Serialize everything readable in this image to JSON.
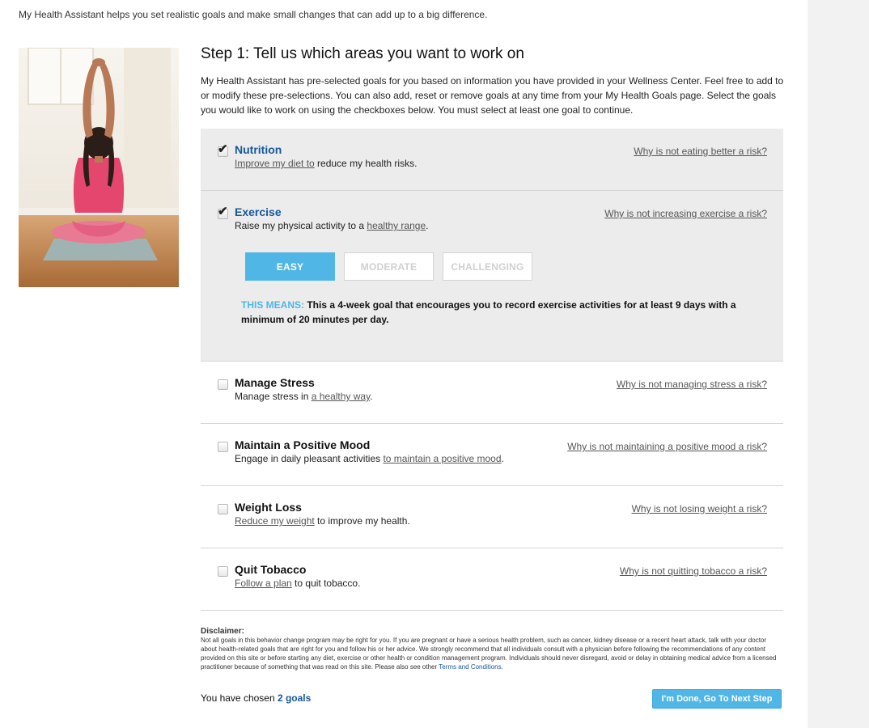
{
  "intro": "My Health Assistant helps you set realistic goals and make small changes that can add up to a big difference.",
  "step": {
    "title": "Step 1: Tell us which areas you want to work on",
    "description": "My Health Assistant has pre-selected goals for you based on information you have provided in your Wellness Center. Feel free to add to or modify these pre-selections. You can also add, reset or remove goals at any time from your My Health Goals page. Select the goals you would like to work on using the checkboxes below. You must select at least one goal to continue."
  },
  "goals": [
    {
      "name": "Nutrition",
      "checked": true,
      "desc_link": "Improve my diet to",
      "desc_after": " reduce my health risks.",
      "risk": "Why is not eating better a risk?"
    },
    {
      "name": "Exercise",
      "checked": true,
      "desc_before": "Raise my physical activity to a ",
      "desc_link": "healthy range",
      "desc_after": ".",
      "risk": "Why is not increasing exercise a risk?",
      "levels": [
        "EASY",
        "MODERATE",
        "CHALLENGING"
      ],
      "selected_level": "EASY",
      "means_label": "THIS MEANS:",
      "means_text": " This a 4-week goal that encourages you to record exercise activities for at least 9 days with a minimum of 20 minutes per day."
    },
    {
      "name": "Manage Stress",
      "checked": false,
      "desc_before": "Manage stress in ",
      "desc_link": "a healthy way",
      "desc_after": ".",
      "risk": "Why is not managing stress a risk?"
    },
    {
      "name": "Maintain a Positive Mood",
      "checked": false,
      "desc_before": "Engage in daily pleasant activities ",
      "desc_link": "to maintain a positive mood",
      "desc_after": ".",
      "risk": "Why is not maintaining a positive mood a risk?"
    },
    {
      "name": "Weight Loss",
      "checked": false,
      "desc_link": "Reduce my weight",
      "desc_after": " to improve my health.",
      "risk": "Why is not losing weight a risk?"
    },
    {
      "name": "Quit Tobacco",
      "checked": false,
      "desc_link": "Follow a plan",
      "desc_after": " to quit tobacco.",
      "risk": "Why is not quitting tobacco a risk?"
    }
  ],
  "disclaimer": {
    "title": "Disclaimer:",
    "text": "Not all goals in this behavior change program may be right for you. If you are pregnant or have a serious health problem, such as cancer, kidney disease or a recent heart attack, talk with your doctor about health-related goals that are right for you and follow his or her advice. We strongly recommend that all individuals consult with a physician before following the recommendations of any content provided on this site or before starting any diet, exercise or other health or condition management program. Individuals should never disregard, avoid or delay in obtaining medical advice from a licensed practitioner because of something that was read on this site. Please also see other ",
    "link": "Terms and Conditions",
    "end": "."
  },
  "footer": {
    "chosen_prefix": "You have chosen ",
    "chosen_count": "2 goals",
    "next_button": "I'm Done, Go To Next Step"
  },
  "icons": {
    "checkbox_checked": "check-icon"
  },
  "colors": {
    "accent": "#4fb6e6",
    "brand_blue": "#17579a",
    "active_row_bg": "#ececec"
  }
}
